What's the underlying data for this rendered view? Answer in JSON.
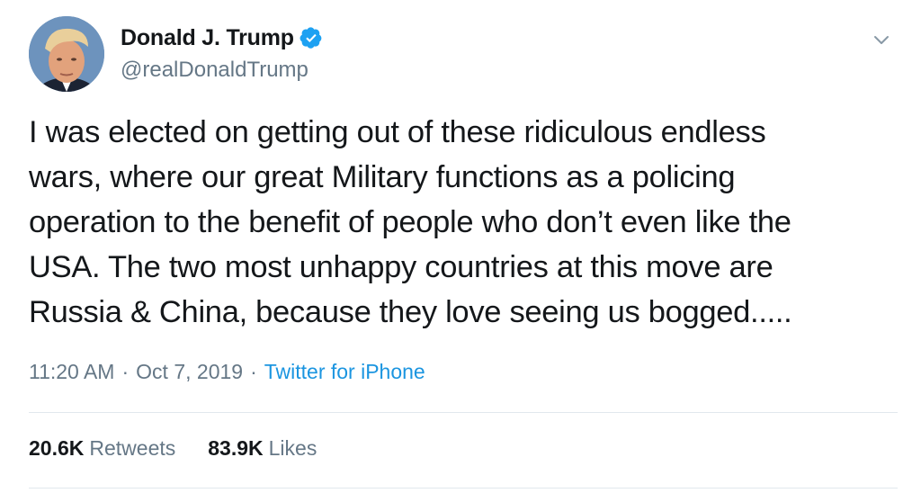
{
  "tweet": {
    "author": {
      "name": "Donald J. Trump",
      "handle": "@realDonaldTrump",
      "verified": true,
      "avatar_icon": "profile-photo"
    },
    "text": "I was elected on getting out of these ridiculous endless\nwars, where our great Military functions as a policing\noperation to the benefit of people who don’t even like the\nUSA. The two most unhappy countries at this move are\nRussia & China, because they love seeing us bogged.....",
    "time": "11:20 AM",
    "date": "Oct 7, 2019",
    "separator": "·",
    "source": "Twitter for iPhone",
    "stats": {
      "retweets_count": "20.6K",
      "retweets_label": "Retweets",
      "likes_count": "83.9K",
      "likes_label": "Likes"
    },
    "menu_icon": "chevron-down-icon"
  },
  "colors": {
    "text": "#14171a",
    "secondary": "#657786",
    "link": "#1b95e0",
    "verified": "#1da1f2",
    "divider": "#e1e8ed"
  }
}
